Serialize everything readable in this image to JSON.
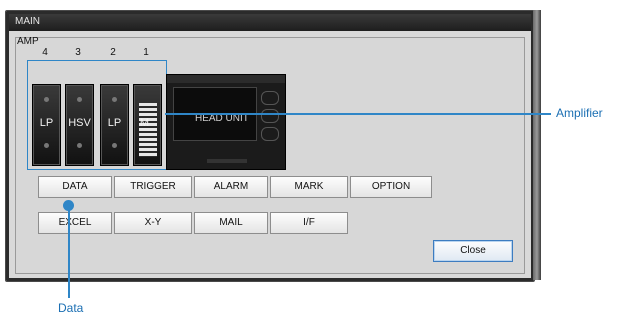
{
  "window": {
    "title": "MAIN"
  },
  "amp": {
    "label": "AMP",
    "channels": [
      "4",
      "3",
      "2",
      "1"
    ],
    "modules": [
      "LP",
      "HSV",
      "LP",
      "M"
    ],
    "head_unit_label": "HEAD UNIT"
  },
  "buttons_row1": [
    "DATA",
    "TRIGGER",
    "ALARM",
    "MARK",
    "OPTION"
  ],
  "buttons_row2": [
    "EXCEL",
    "X-Y",
    "MAIL",
    "I/F"
  ],
  "close_label": "Close",
  "callouts": {
    "amplifier": "Amplifier",
    "data": "Data"
  },
  "colors": {
    "callout_blue": "#2f86c7",
    "window_bg": "#d9d9d9",
    "titlebar": "#1e1e1e"
  }
}
